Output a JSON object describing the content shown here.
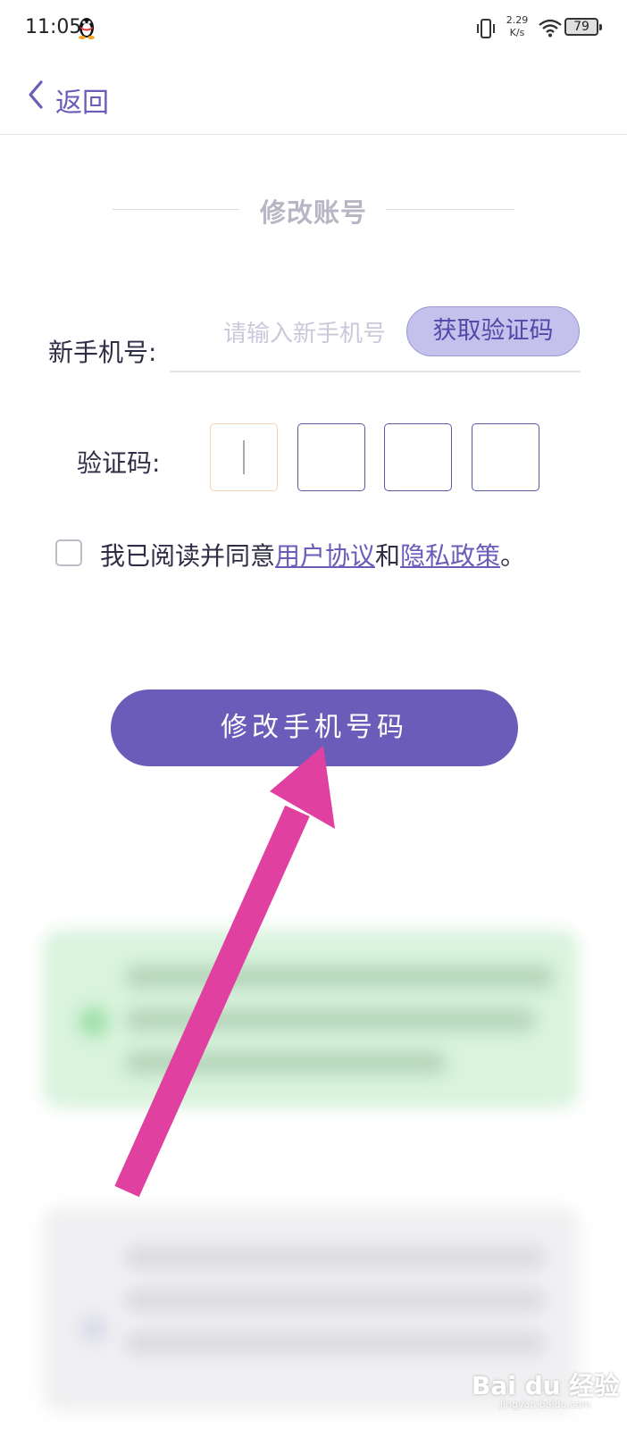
{
  "status_bar": {
    "time": "11:05",
    "net_speed_value": "2.29",
    "net_speed_unit": "K/s",
    "battery": "79"
  },
  "nav": {
    "back_label": "返回"
  },
  "form": {
    "title": "修改账号",
    "phone_label": "新手机号:",
    "phone_placeholder": "请输入新手机号",
    "get_code_label": "获取验证码",
    "code_label": "验证码:",
    "agree_prefix": "我已阅读并同意",
    "user_agreement": "用户协议",
    "agree_and": "和",
    "privacy_policy": "隐私政策",
    "agree_suffix": "。",
    "submit_label": "修改手机号码"
  },
  "watermark": {
    "brand": "Bai du 经验",
    "url": "jingyan.baidu.com"
  },
  "colors": {
    "accent": "#6a5cb8",
    "annotation_arrow": "#e040a0"
  }
}
